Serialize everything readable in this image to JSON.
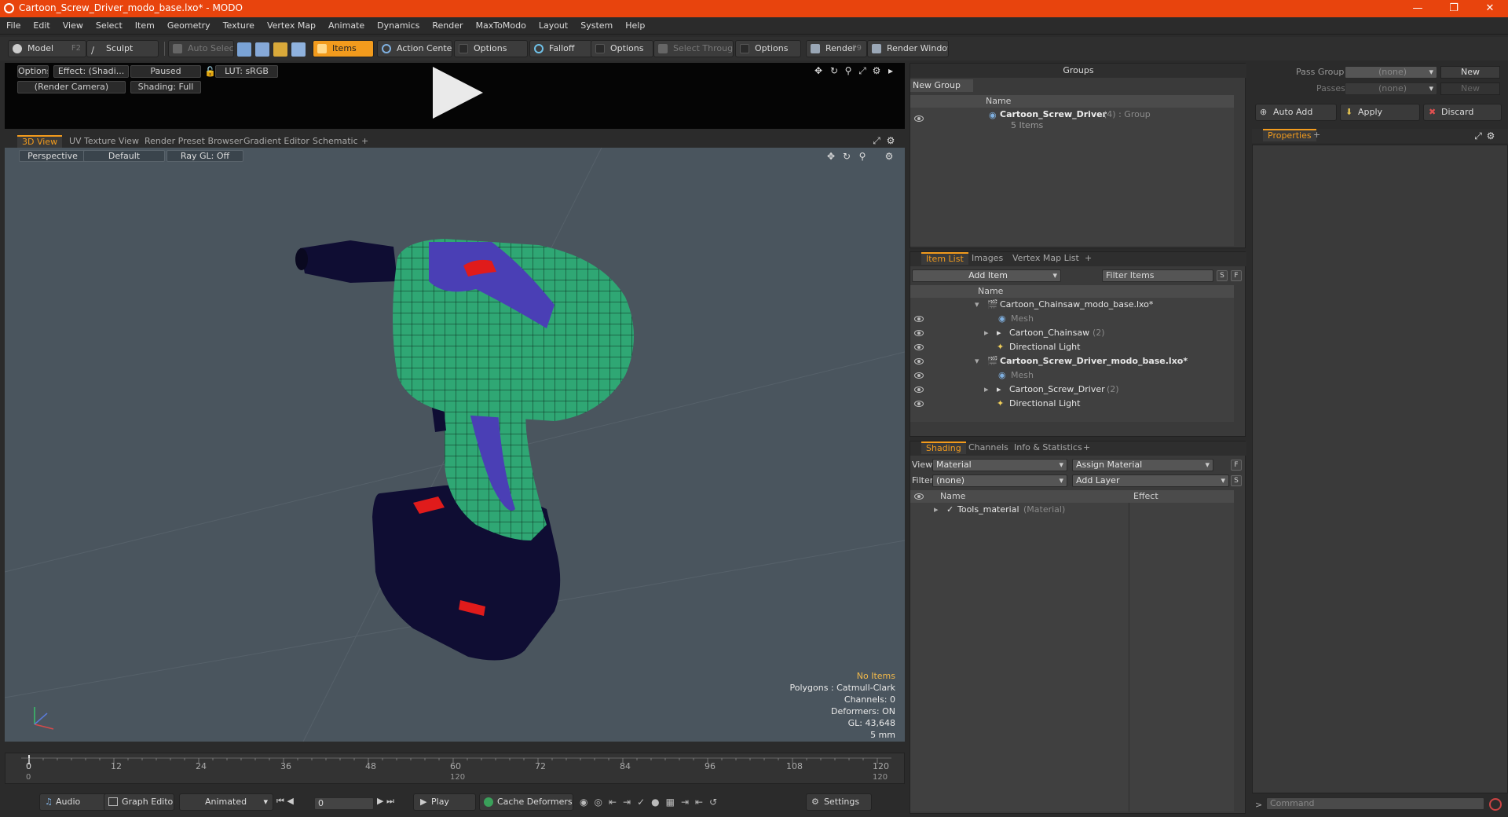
{
  "window": {
    "title": "Cartoon_Screw_Driver_modo_base.lxo* - MODO",
    "minimize": "—",
    "restore": "❐",
    "close": "✕"
  },
  "menu": [
    "File",
    "Edit",
    "View",
    "Select",
    "Item",
    "Geometry",
    "Texture",
    "Vertex Map",
    "Animate",
    "Dynamics",
    "Render",
    "MaxToModo",
    "Layout",
    "System",
    "Help"
  ],
  "toolbar": {
    "model": "Model",
    "model_key": "F2",
    "sculpt": "Sculpt",
    "auto_select": "Auto Select",
    "items": "Items",
    "action_center": "Action Center",
    "options1": "Options",
    "falloff": "Falloff",
    "options2": "Options",
    "select_through": "Select Through",
    "options3": "Options",
    "render": "Render",
    "render_key": "F9",
    "render_window": "Render Window"
  },
  "preview": {
    "options": "Options",
    "effect": "Effect: (Shadi...",
    "paused": "Paused",
    "lut": "LUT: sRGB",
    "camera": "(Render Camera)",
    "shading": "Shading: Full"
  },
  "viewport_tabs": [
    "3D View",
    "UV Texture View",
    "Render Preset Browser",
    "Gradient Editor",
    "Schematic",
    "+"
  ],
  "viewport": {
    "perspective": "Perspective",
    "default": "Default",
    "raygl": "Ray GL: Off",
    "stats": {
      "no_items": "No Items",
      "polygons": "Polygons : Catmull-Clark",
      "channels": "Channels: 0",
      "deformers": "Deformers: ON",
      "gl": "GL: 43,648",
      "scale": "5 mm"
    }
  },
  "timeline": {
    "ticks": [
      "0",
      "12",
      "24",
      "36",
      "48",
      "60",
      "72",
      "84",
      "96",
      "108",
      "120"
    ],
    "sub_start": "0",
    "sub_mid": "120",
    "sub_end": "120"
  },
  "transport": {
    "audio": "Audio",
    "graph_editor": "Graph Editor",
    "animated": "Animated",
    "frame": "0",
    "play": "Play",
    "cache": "Cache Deformers",
    "settings": "Settings"
  },
  "groups": {
    "title": "Groups",
    "new_group": "New Group",
    "col_name": "Name",
    "item_name": "Cartoon_Screw_Driver",
    "item_count": "(4)",
    "item_type": ": Group",
    "item_sub": "5 Items"
  },
  "item_list": {
    "tabs": [
      "Item List",
      "Images",
      "Vertex Map List",
      "+"
    ],
    "add_item": "Add Item",
    "filter": "Filter Items",
    "s_btn": "S",
    "f_btn": "F",
    "col_name": "Name",
    "rows": [
      {
        "label": "Cartoon_Chainsaw_modo_base.lxo*",
        "count": ""
      },
      {
        "label": "Mesh",
        "count": ""
      },
      {
        "label": "Cartoon_Chainsaw",
        "count": "(2)"
      },
      {
        "label": "Directional Light",
        "count": ""
      },
      {
        "label": "Cartoon_Screw_Driver_modo_base.lxo*",
        "count": ""
      },
      {
        "label": "Mesh",
        "count": ""
      },
      {
        "label": "Cartoon_Screw_Driver",
        "count": "(2)"
      },
      {
        "label": "Directional Light",
        "count": ""
      }
    ]
  },
  "shading": {
    "tabs": [
      "Shading",
      "Channels",
      "Info & Statistics",
      "+"
    ],
    "view_label": "View",
    "view_value": "Material",
    "assign": "Assign Material",
    "f_btn": "F",
    "filter_label": "Filter",
    "filter_value": "(none)",
    "add_layer": "Add Layer",
    "s_btn": "S",
    "col_name": "Name",
    "col_effect": "Effect",
    "row_name": "Tools_material",
    "row_type": "(Material)"
  },
  "right": {
    "pass_groups_label": "Pass Groups",
    "pass_groups_value": "(none)",
    "new": "New",
    "passes_label": "Passes",
    "passes_value": "(none)",
    "new2": "New",
    "auto_add": "Auto Add",
    "apply": "Apply",
    "discard": "Discard",
    "properties": "Properties",
    "plus": "+",
    "command": "Command"
  },
  "colors": {
    "accent": "#f29b1d",
    "titlebar": "#e8440d",
    "viewport_bg": "#4a555e",
    "drill_green": "#2fa774",
    "drill_blue": "#4a3fb5",
    "battery": "#0f0d33",
    "red": "#e01b1b"
  }
}
